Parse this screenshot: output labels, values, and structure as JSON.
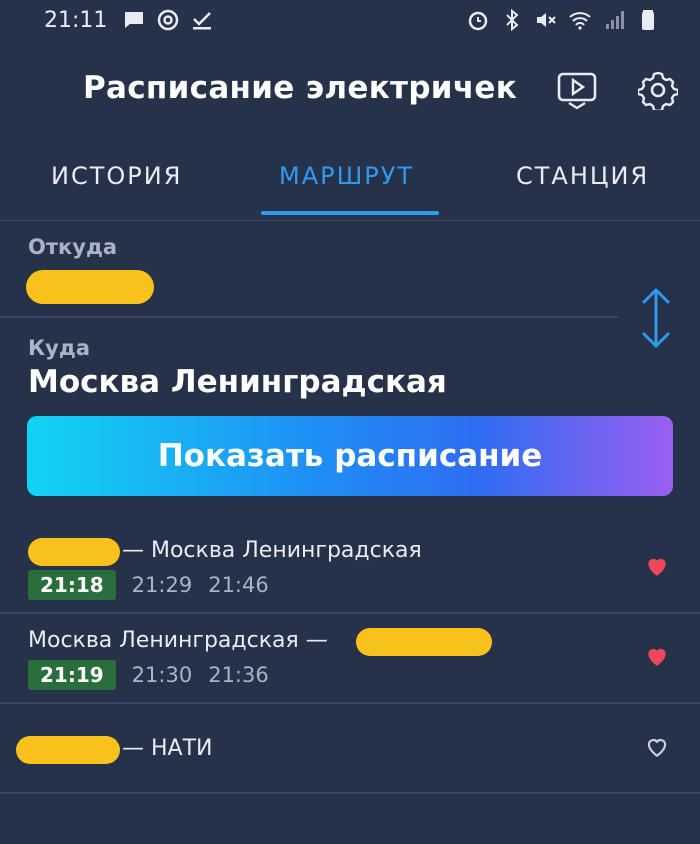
{
  "status_bar": {
    "time": "21:11",
    "left_icons": [
      "chat-icon",
      "at-icon",
      "check-icon"
    ],
    "right_icons": [
      "alarm-icon",
      "bluetooth-icon",
      "mute-icon",
      "wifi-icon",
      "signal-icon",
      "battery-icon"
    ]
  },
  "app": {
    "title": "Расписание электричек",
    "buttons": [
      "video-icon",
      "gear-icon"
    ]
  },
  "tabs": [
    {
      "label": "ИСТОРИЯ",
      "active": false
    },
    {
      "label": "МАРШРУТ",
      "active": true
    },
    {
      "label": "СТАНЦИЯ",
      "active": false
    }
  ],
  "form": {
    "from_label": "Откуда",
    "from_value": "",
    "to_label": "Куда",
    "to_value": "Москва Ленинградская",
    "show_button": "Показать расписание"
  },
  "routes": [
    {
      "prefix": "",
      "title": "— Москва Ленинградская",
      "time": "21:18",
      "next1": "21:29",
      "next2": "21:46",
      "favorite": true
    },
    {
      "prefix": "Москва Ленинградская —",
      "title": "",
      "time": "21:19",
      "next1": "21:30",
      "next2": "21:36",
      "favorite": true
    },
    {
      "prefix": "",
      "title": "— НАТИ",
      "time": "",
      "next1": "",
      "next2": "",
      "favorite": false
    }
  ],
  "colors": {
    "background": "#26324a",
    "accent": "#2e9bf0",
    "badge": "#2a6e3c",
    "heart": "#f0475e",
    "redaction": "#f7c21b"
  }
}
